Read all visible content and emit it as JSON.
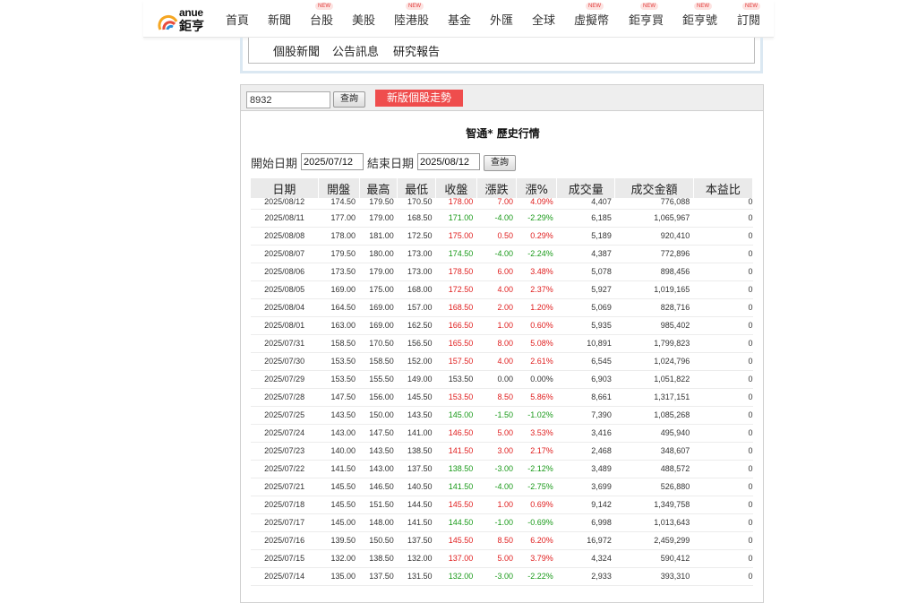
{
  "brand": {
    "name_en": "anue",
    "name_zh": "鉅亨"
  },
  "nav": [
    {
      "label": "首頁",
      "badge": ""
    },
    {
      "label": "新聞",
      "badge": ""
    },
    {
      "label": "台股",
      "badge": "NEW"
    },
    {
      "label": "美股",
      "badge": ""
    },
    {
      "label": "陸港股",
      "badge": "NEW"
    },
    {
      "label": "基金",
      "badge": ""
    },
    {
      "label": "外匯",
      "badge": ""
    },
    {
      "label": "全球",
      "badge": ""
    },
    {
      "label": "虛擬幣",
      "badge": "NEW"
    },
    {
      "label": "鉅亨買",
      "badge": "NEW"
    },
    {
      "label": "鉅亨號",
      "badge": "NEW"
    },
    {
      "label": "訂閱",
      "badge": "NEW"
    }
  ],
  "sub_links": [
    "個股新聞",
    "公告訊息",
    "研究報告"
  ],
  "search": {
    "code_value": "8932",
    "query_label": "查詢",
    "trend_button": "新版個股走勢"
  },
  "page_title": "智通* 歷史行情",
  "date_filter": {
    "start_label": "開始日期",
    "start_value": "2025/07/12",
    "end_label": "結束日期",
    "end_value": "2025/08/12",
    "query_label": "查詢"
  },
  "table": {
    "headers": [
      "日期",
      "開盤",
      "最高",
      "最低",
      "收盤",
      "漲跌",
      "漲%",
      "成交量",
      "成交金額",
      "本益比"
    ],
    "rows": [
      [
        "2025/08/12",
        "174.50",
        "179.50",
        "170.50",
        "178.00",
        "7.00",
        "4.09%",
        "4,407",
        "776,088",
        "0"
      ],
      [
        "2025/08/11",
        "177.00",
        "179.00",
        "168.50",
        "171.00",
        "-4.00",
        "-2.29%",
        "6,185",
        "1,065,967",
        "0"
      ],
      [
        "2025/08/08",
        "178.00",
        "181.00",
        "172.50",
        "175.00",
        "0.50",
        "0.29%",
        "5,189",
        "920,410",
        "0"
      ],
      [
        "2025/08/07",
        "179.50",
        "180.00",
        "173.00",
        "174.50",
        "-4.00",
        "-2.24%",
        "4,387",
        "772,896",
        "0"
      ],
      [
        "2025/08/06",
        "173.50",
        "179.00",
        "173.00",
        "178.50",
        "6.00",
        "3.48%",
        "5,078",
        "898,456",
        "0"
      ],
      [
        "2025/08/05",
        "169.00",
        "175.00",
        "168.00",
        "172.50",
        "4.00",
        "2.37%",
        "5,927",
        "1,019,165",
        "0"
      ],
      [
        "2025/08/04",
        "164.50",
        "169.00",
        "157.00",
        "168.50",
        "2.00",
        "1.20%",
        "5,069",
        "828,716",
        "0"
      ],
      [
        "2025/08/01",
        "163.00",
        "169.00",
        "162.50",
        "166.50",
        "1.00",
        "0.60%",
        "5,935",
        "985,402",
        "0"
      ],
      [
        "2025/07/31",
        "158.50",
        "170.50",
        "156.50",
        "165.50",
        "8.00",
        "5.08%",
        "10,891",
        "1,799,823",
        "0"
      ],
      [
        "2025/07/30",
        "153.50",
        "158.50",
        "152.00",
        "157.50",
        "4.00",
        "2.61%",
        "6,545",
        "1,024,796",
        "0"
      ],
      [
        "2025/07/29",
        "153.50",
        "155.50",
        "149.00",
        "153.50",
        "0.00",
        "0.00%",
        "6,903",
        "1,051,822",
        "0"
      ],
      [
        "2025/07/28",
        "147.50",
        "156.00",
        "145.50",
        "153.50",
        "8.50",
        "5.86%",
        "8,661",
        "1,317,151",
        "0"
      ],
      [
        "2025/07/25",
        "143.50",
        "150.00",
        "143.50",
        "145.00",
        "-1.50",
        "-1.02%",
        "7,390",
        "1,085,268",
        "0"
      ],
      [
        "2025/07/24",
        "143.00",
        "147.50",
        "141.00",
        "146.50",
        "5.00",
        "3.53%",
        "3,416",
        "495,940",
        "0"
      ],
      [
        "2025/07/23",
        "140.00",
        "143.50",
        "138.50",
        "141.50",
        "3.00",
        "2.17%",
        "2,468",
        "348,607",
        "0"
      ],
      [
        "2025/07/22",
        "141.50",
        "143.00",
        "137.50",
        "138.50",
        "-3.00",
        "-2.12%",
        "3,489",
        "488,572",
        "0"
      ],
      [
        "2025/07/21",
        "145.50",
        "146.50",
        "140.50",
        "141.50",
        "-4.00",
        "-2.75%",
        "3,699",
        "526,880",
        "0"
      ],
      [
        "2025/07/18",
        "145.50",
        "151.50",
        "144.50",
        "145.50",
        "1.00",
        "0.69%",
        "9,142",
        "1,349,758",
        "0"
      ],
      [
        "2025/07/17",
        "145.00",
        "148.00",
        "141.50",
        "144.50",
        "-1.00",
        "-0.69%",
        "6,998",
        "1,013,643",
        "0"
      ],
      [
        "2025/07/16",
        "139.50",
        "150.50",
        "137.50",
        "145.50",
        "8.50",
        "6.20%",
        "16,972",
        "2,459,299",
        "0"
      ],
      [
        "2025/07/15",
        "132.00",
        "138.50",
        "132.00",
        "137.00",
        "5.00",
        "3.79%",
        "4,324",
        "590,412",
        "0"
      ],
      [
        "2025/07/14",
        "135.00",
        "137.50",
        "131.50",
        "132.00",
        "-3.00",
        "-2.22%",
        "2,933",
        "393,310",
        "0"
      ]
    ]
  },
  "colors": {
    "up": "#e02020",
    "down": "#1a9a1a",
    "accent": "#ef4d4d"
  }
}
